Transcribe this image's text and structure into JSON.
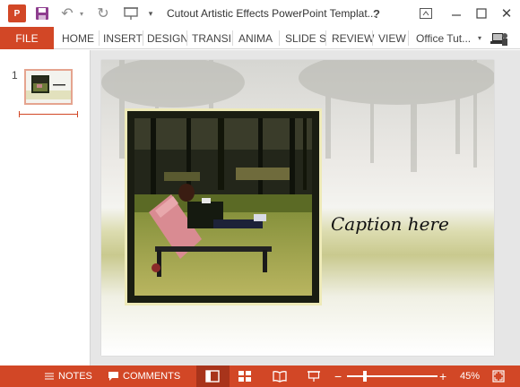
{
  "window": {
    "title": "Cutout Artistic Effects PowerPoint Templat...",
    "app_logo": "P",
    "help": "?",
    "accent": "#d24726"
  },
  "icons": [
    "powerpoint-logo-icon",
    "save-icon",
    "undo-icon",
    "redo-icon",
    "present-icon",
    "customize-dropdown-icon",
    "help-icon",
    "ribbon-display-icon",
    "minimize-icon",
    "maximize-icon",
    "close-icon"
  ],
  "ribbon": {
    "file": "FILE",
    "tabs": [
      "HOME",
      "INSERT",
      "DESIGN",
      "TRANSI",
      "ANIMA",
      "SLIDE S",
      "REVIEW",
      "VIEW"
    ],
    "account": "Office Tut..."
  },
  "thumbnails": [
    {
      "number": "1"
    }
  ],
  "slide": {
    "caption": "Caption here"
  },
  "statusbar": {
    "notes": "NOTES",
    "comments": "COMMENTS",
    "zoom": "45%",
    "zoom_level": 0.45
  }
}
